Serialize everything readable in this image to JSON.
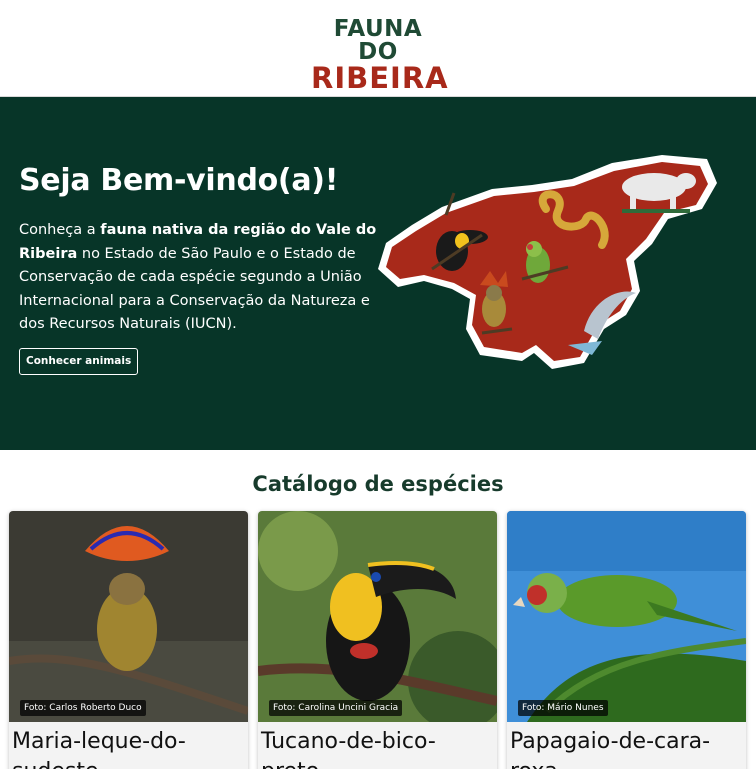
{
  "header": {
    "logo_line1": "FAUNA DO",
    "logo_line2": "RIBEIRA"
  },
  "hero": {
    "title": "Seja Bem-vindo(a)!",
    "text_1": "Conheça a ",
    "text_bold": "fauna nativa da região do Vale do Ribeira",
    "text_2": " no Estado de São Paulo e o Estado de Conservação de cada espécie segundo a União Internacional para a Conservação da Natureza e dos Recursos Naturais (IUCN).",
    "button_label": "Conhecer animais"
  },
  "catalog": {
    "title": "Catálogo de espécies",
    "cards": [
      {
        "name": "Maria-leque-do-sudeste",
        "credit": "Foto: Carlos Roberto Duco"
      },
      {
        "name": "Tucano-de-bico-preto",
        "credit": "Foto: Carolina Uncini Gracia"
      },
      {
        "name": "Papagaio-de-cara-roxa",
        "credit": "Foto: Mário Nunes"
      }
    ]
  },
  "colors": {
    "brand_green": "#073528",
    "brand_red": "#a8291a",
    "title_green": "#173b2c"
  }
}
